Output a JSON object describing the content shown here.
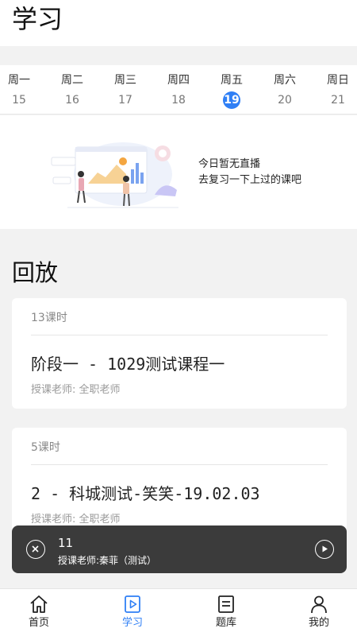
{
  "header": {
    "title": "学习"
  },
  "week": [
    {
      "name": "周一",
      "num": "15"
    },
    {
      "name": "周二",
      "num": "16"
    },
    {
      "name": "周三",
      "num": "17"
    },
    {
      "name": "周四",
      "num": "18"
    },
    {
      "name": "周五",
      "num": "19"
    },
    {
      "name": "周六",
      "num": "20"
    },
    {
      "name": "周日",
      "num": "21"
    }
  ],
  "selected_day": "19",
  "empty": {
    "line1": "今日暂无直播",
    "line2": "去复习一下上过的课吧"
  },
  "replay": {
    "title": "回放",
    "cards": [
      {
        "count": "13课时",
        "title": "阶段一 - 1029测试课程一",
        "teacher": "授课老师: 全职老师"
      },
      {
        "count": "5课时",
        "title": "2 - 科城测试-笑笑-19.02.03",
        "teacher": "授课老师: 全职老师"
      }
    ]
  },
  "player": {
    "title": "11",
    "teacher": "授课老师:秦菲（测试）"
  },
  "tabs": [
    {
      "label": "首页",
      "icon": "home-icon"
    },
    {
      "label": "学习",
      "icon": "play-square-icon"
    },
    {
      "label": "题库",
      "icon": "document-icon"
    },
    {
      "label": "我的",
      "icon": "user-icon"
    }
  ],
  "active_tab": "学习",
  "colors": {
    "accent": "#2f7ff5",
    "player_bg": "#3b3b3b"
  }
}
